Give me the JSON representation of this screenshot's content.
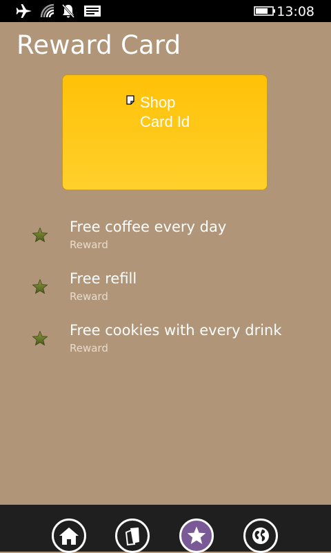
{
  "status_bar": {
    "time": "13:08",
    "icons": [
      "airplane-mode-icon",
      "wifi-signal-icon",
      "quiet-hours-icon",
      "message-icon",
      "battery-icon"
    ]
  },
  "page": {
    "title": "Reward Card"
  },
  "card": {
    "text_line1": "Shop",
    "text_line2": "Card Id",
    "gradient_top": "#ffc107",
    "gradient_bottom": "#ffd02c"
  },
  "rewards": [
    {
      "title": "Free coffee every day",
      "subtitle": "Reward"
    },
    {
      "title": "Free refill",
      "subtitle": "Reward"
    },
    {
      "title": "Free cookies with every drink",
      "subtitle": "Reward"
    }
  ],
  "app_bar": {
    "buttons": [
      {
        "icon": "home-icon",
        "active": false
      },
      {
        "icon": "cards-icon",
        "active": false
      },
      {
        "icon": "star-icon",
        "active": true
      },
      {
        "icon": "globe-icon",
        "active": false
      }
    ]
  },
  "colors": {
    "background": "#b09579",
    "status_bar": "#000000",
    "app_bar": "#1f1f1f",
    "accent": "#7a5a96",
    "star": "#5d6a2a"
  }
}
